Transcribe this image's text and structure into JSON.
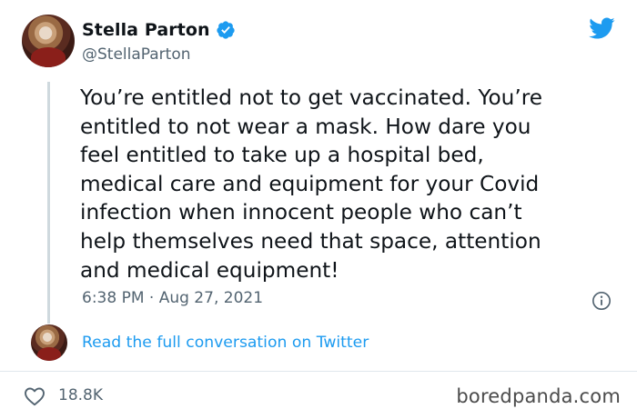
{
  "author": {
    "display_name": "Stella Parton",
    "handle": "@StellaParton",
    "verified": true
  },
  "tweet": {
    "text": "You’re entitled not to get vaccinated. You’re\nentitled to not wear a mask. How dare you\nfeel entitled to take up a hospital bed,\nmedical care and equipment for your Covid\ninfection when innocent people who can’t\nhelp themselves need that space, attention\nand medical equipment!",
    "timestamp": "6:38 PM · Aug 27, 2021"
  },
  "actions": {
    "read_conversation_label": "Read the full conversation on Twitter",
    "like_count": "18.8K"
  },
  "watermark": "boredpanda.com",
  "icons": {
    "brand": "twitter-bird-icon",
    "verified": "verified-badge-icon",
    "info": "info-icon",
    "like": "heart-icon"
  },
  "colors": {
    "twitter_blue": "#1d9bf0",
    "text_primary": "#0f1419",
    "text_secondary": "#536471",
    "thread_line": "#cfd9de"
  }
}
